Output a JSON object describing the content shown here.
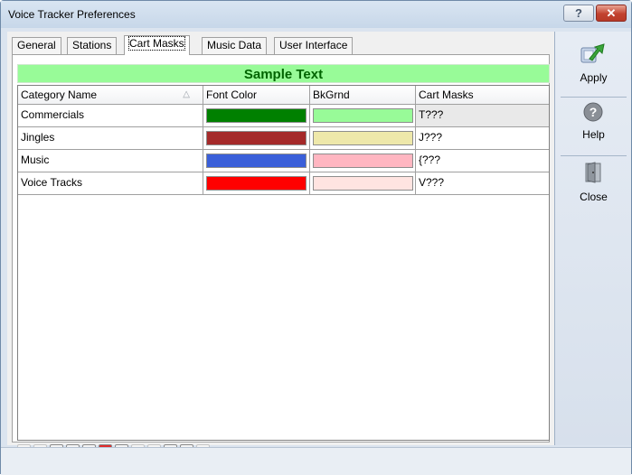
{
  "window": {
    "title": "Voice Tracker Preferences",
    "help_glyph": "?",
    "close_glyph": "✕"
  },
  "tabs": [
    {
      "label": "General"
    },
    {
      "label": "Stations"
    },
    {
      "label": "Cart Masks",
      "active": true
    },
    {
      "label": "Music Data"
    },
    {
      "label": "User Interface"
    }
  ],
  "sample_text": {
    "label": "Sample Text",
    "text_color": "#006400",
    "background": "#98fb98"
  },
  "grid": {
    "columns": [
      "Category Name",
      "Font Color",
      "BkGrnd",
      "Cart Masks"
    ],
    "sort_indicator": "△",
    "rows": [
      {
        "name": "Commercials",
        "font_color": "#008000",
        "bkgrnd": "#98fb98",
        "mask": "T???"
      },
      {
        "name": "Jingles",
        "font_color": "#a52a2a",
        "bkgrnd": "#eee8aa",
        "mask": "J???"
      },
      {
        "name": "Music",
        "font_color": "#3a5fd9",
        "bkgrnd": "#ffb6c1",
        "mask": "{???"
      },
      {
        "name": "Voice Tracks",
        "font_color": "#ff0000",
        "bkgrnd": "#ffe4e1",
        "mask": "V???"
      }
    ]
  },
  "navigator": {
    "buttons": [
      {
        "name": "first",
        "glyph": "⏮"
      },
      {
        "name": "prior",
        "glyph": "◀"
      },
      {
        "name": "next",
        "glyph": "▶"
      },
      {
        "name": "last",
        "glyph": "⏭"
      },
      {
        "name": "insert",
        "glyph": "+"
      },
      {
        "name": "delete",
        "glyph": "−"
      },
      {
        "name": "edit",
        "glyph": "▲"
      },
      {
        "name": "post",
        "glyph": "✓"
      },
      {
        "name": "cancel",
        "glyph": "✕"
      },
      {
        "name": "refresh",
        "glyph": "↻"
      },
      {
        "name": "apply-filter",
        "glyph": "✱"
      },
      {
        "name": "clear-filter",
        "glyph": "✳"
      }
    ],
    "scroll_left": "◂",
    "scroll_right": "▸"
  },
  "side_buttons": {
    "apply": {
      "label": "Apply",
      "icon": "apply-icon"
    },
    "help": {
      "label": "Help",
      "icon": "help-icon"
    },
    "close": {
      "label": "Close",
      "icon": "door-icon"
    }
  }
}
